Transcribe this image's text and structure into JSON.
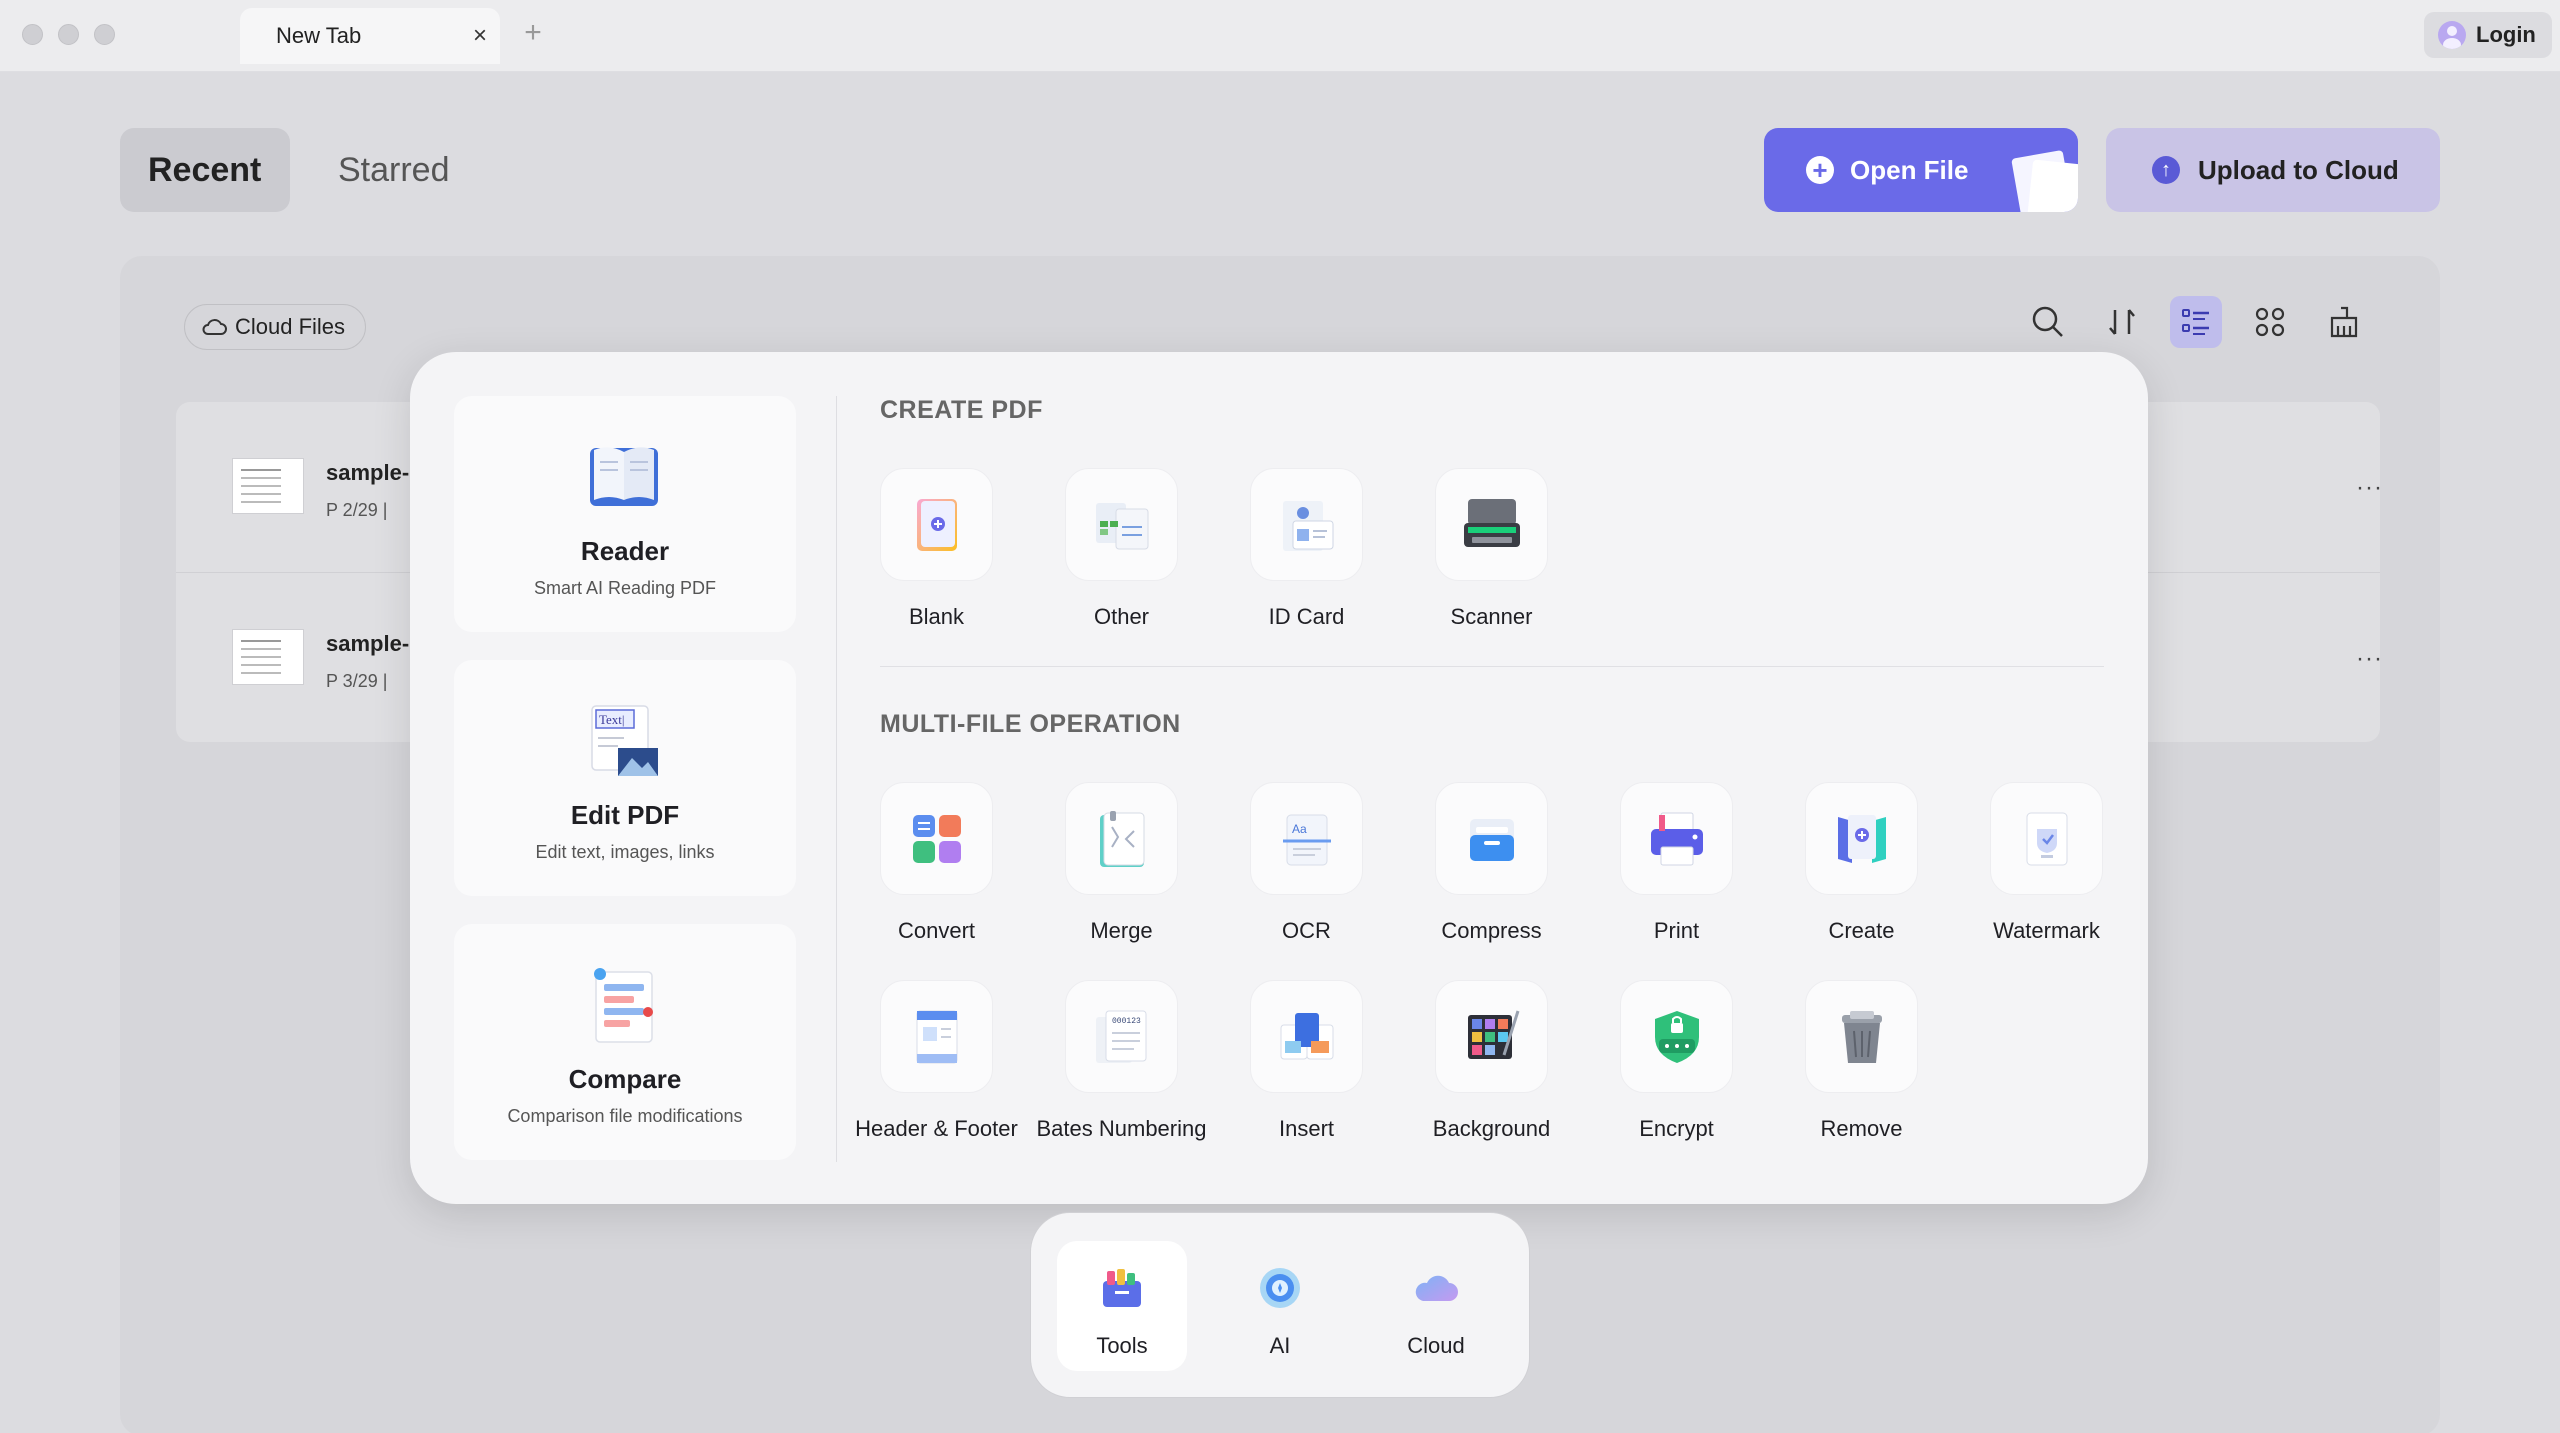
{
  "window": {
    "tab_title": "New Tab",
    "tab_close": "×",
    "tab_add": "+",
    "login_label": "Login"
  },
  "header": {
    "tabs": [
      "Recent",
      "Starred"
    ],
    "open_file_label": "Open File",
    "upload_label": "Upload to Cloud"
  },
  "files": {
    "cloud_files_label": "Cloud Files",
    "rows": [
      {
        "name": "sample-",
        "meta": "P 2/29  |",
        "more": "···"
      },
      {
        "name": "sample-",
        "meta": "P 3/29  |",
        "more": "···"
      }
    ]
  },
  "tools_panel": {
    "left_cards": [
      {
        "title": "Reader",
        "subtitle": "Smart AI Reading PDF",
        "icon": "book-icon"
      },
      {
        "title": "Edit PDF",
        "subtitle": "Edit text, images, links",
        "icon": "text-edit-icon"
      },
      {
        "title": "Compare",
        "subtitle": "Comparison file modifications",
        "icon": "compare-icon"
      }
    ],
    "create_title": "CREATE PDF",
    "create_tools": [
      "Blank",
      "Other",
      "ID Card",
      "Scanner"
    ],
    "multi_title": "MULTI-FILE OPERATION",
    "multi_tools_row1": [
      "Convert",
      "Merge",
      "OCR",
      "Compress",
      "Print",
      "Create",
      "Watermark"
    ],
    "multi_tools_row2": [
      "Header & Footer",
      "Bates Numbering",
      "Insert",
      "Background",
      "Encrypt",
      "Remove"
    ]
  },
  "dock": {
    "items": [
      {
        "label": "Tools",
        "icon": "toolbox-icon",
        "active": true
      },
      {
        "label": "AI",
        "icon": "ai-icon",
        "active": false
      },
      {
        "label": "Cloud",
        "icon": "cloud-icon",
        "active": false
      }
    ]
  },
  "colors": {
    "accent": "#6a6ae8",
    "upload_bg": "#c9c4e6",
    "panel_bg": "#f4f4f6"
  }
}
